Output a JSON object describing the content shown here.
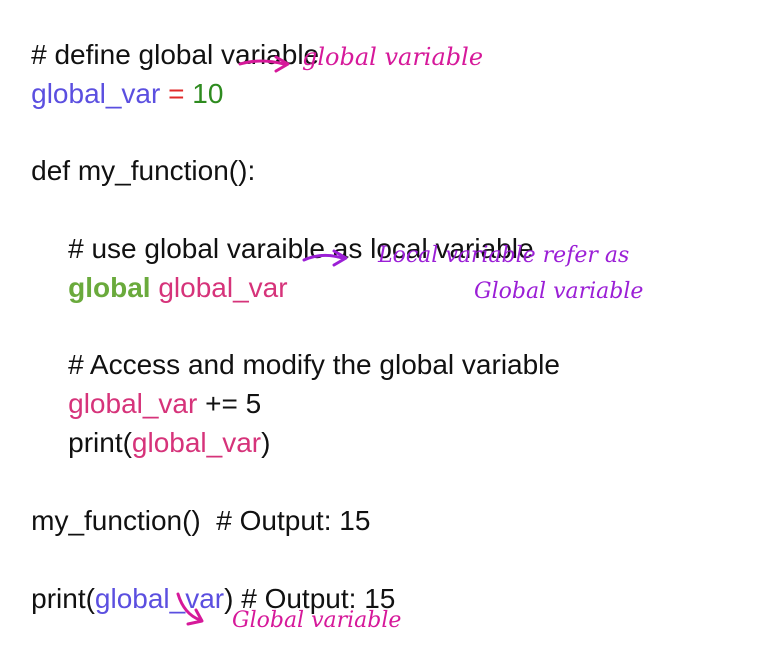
{
  "colors": {
    "text": "#111111",
    "var_blue": "#5b4fe0",
    "var_pink": "#d6337a",
    "operator_red": "#e02a2a",
    "number_green": "#2e8b1f",
    "keyword_green": "#6aaa3c",
    "annotation_pink": "#d6199a",
    "annotation_purple": "#9b1fd6"
  },
  "code": {
    "l1": {
      "text": "# define global variable"
    },
    "l2": {
      "var": "global_var",
      "op": " = ",
      "num": "10"
    },
    "l3": {
      "text": "def my_function():"
    },
    "l4": {
      "text": "# use global varaible as local variable"
    },
    "l5": {
      "kw": "global",
      "var": " global_var"
    },
    "l6": {
      "text": "# Access and modify the global variable"
    },
    "l7": {
      "var": "global_var",
      "rest": " += 5"
    },
    "l8": {
      "pre": "print(",
      "var": "global_var",
      "post": ")"
    },
    "l9": {
      "text": "my_function()  # Output: 15"
    },
    "l10": {
      "pre": "print(",
      "var": "global_var",
      "post": ") # Output: 15"
    }
  },
  "annotations": {
    "a1": "global variable",
    "a2_line1": "Local variable refer as",
    "a2_line2": "Global variable",
    "a3": "Global variable"
  }
}
